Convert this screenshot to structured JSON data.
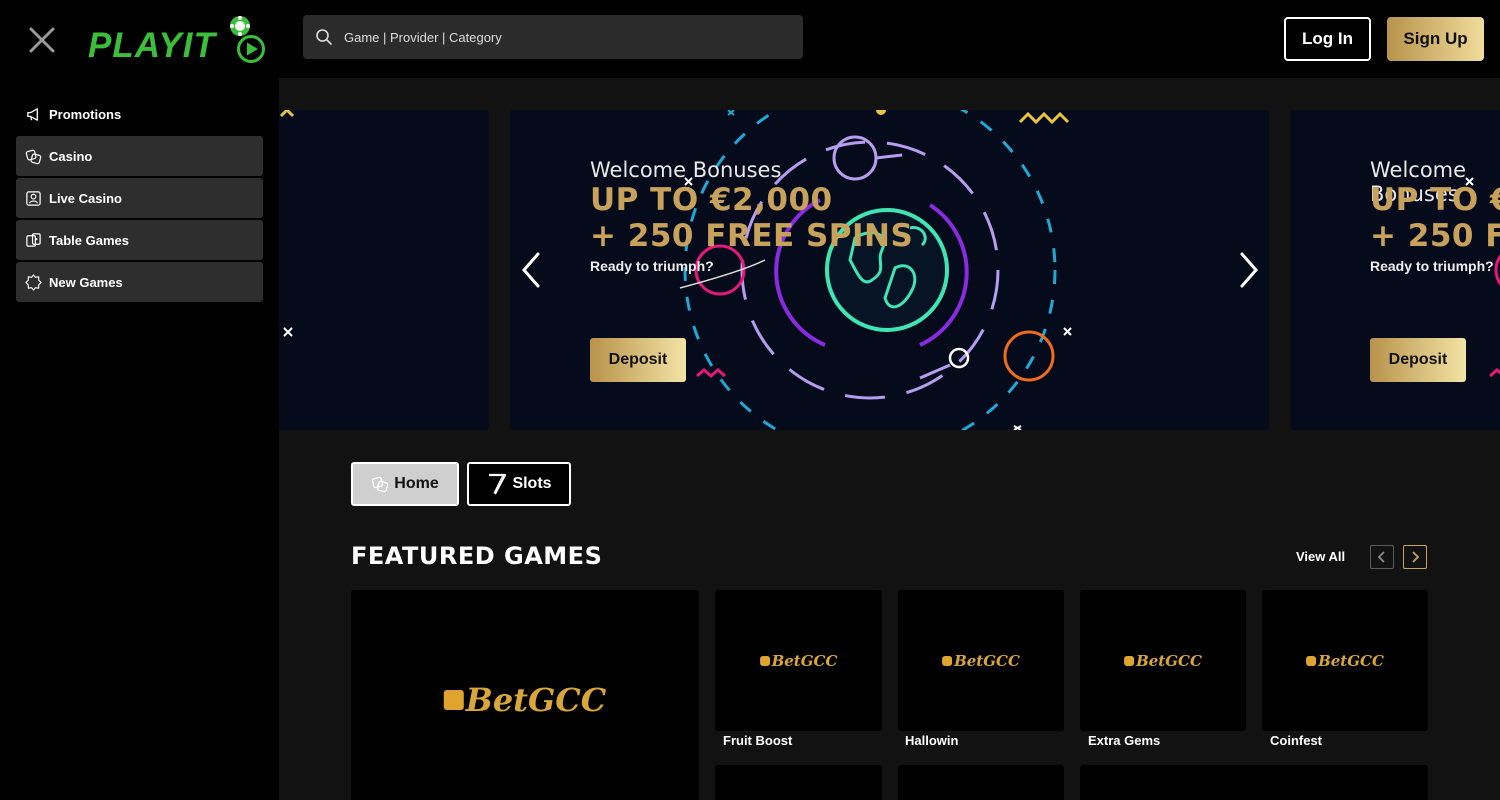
{
  "header": {
    "logo_text": "PLAYIT",
    "search_placeholder": "Game | Provider | Category",
    "login_label": "Log In",
    "signup_label": "Sign Up"
  },
  "sidebar": {
    "items": [
      {
        "label": "Promotions",
        "icon": "megaphone-icon"
      },
      {
        "label": "Casino",
        "icon": "chips-icon"
      },
      {
        "label": "Live Casino",
        "icon": "live-dealer-icon"
      },
      {
        "label": "Table Games",
        "icon": "table-games-icon"
      },
      {
        "label": "New Games",
        "icon": "new-badge-icon"
      }
    ]
  },
  "banner": {
    "title": "Welcome Bonuses",
    "line1": "UP TO €2,000",
    "line2": "+ 250 FREE SPINS",
    "subtitle": "Ready to triumph?",
    "cta": "Deposit"
  },
  "tabs": [
    {
      "label": "Home",
      "icon": "chips-icon"
    },
    {
      "label": "Slots",
      "icon": "seven-icon"
    }
  ],
  "featured": {
    "title": "FEATURED GAMES",
    "view_all": "View All",
    "provider_logo_text": "BetGCC",
    "games": [
      "Fruit Boost",
      "Hallowin",
      "Extra Gems",
      "Coinfest"
    ]
  },
  "colors": {
    "accent_gold": "#c8a25a",
    "brand_green": "#3bbf3b",
    "sidebar_item_bg": "#2e2e2e",
    "main_bg": "#121212",
    "banner_bg": "#050b1a"
  }
}
